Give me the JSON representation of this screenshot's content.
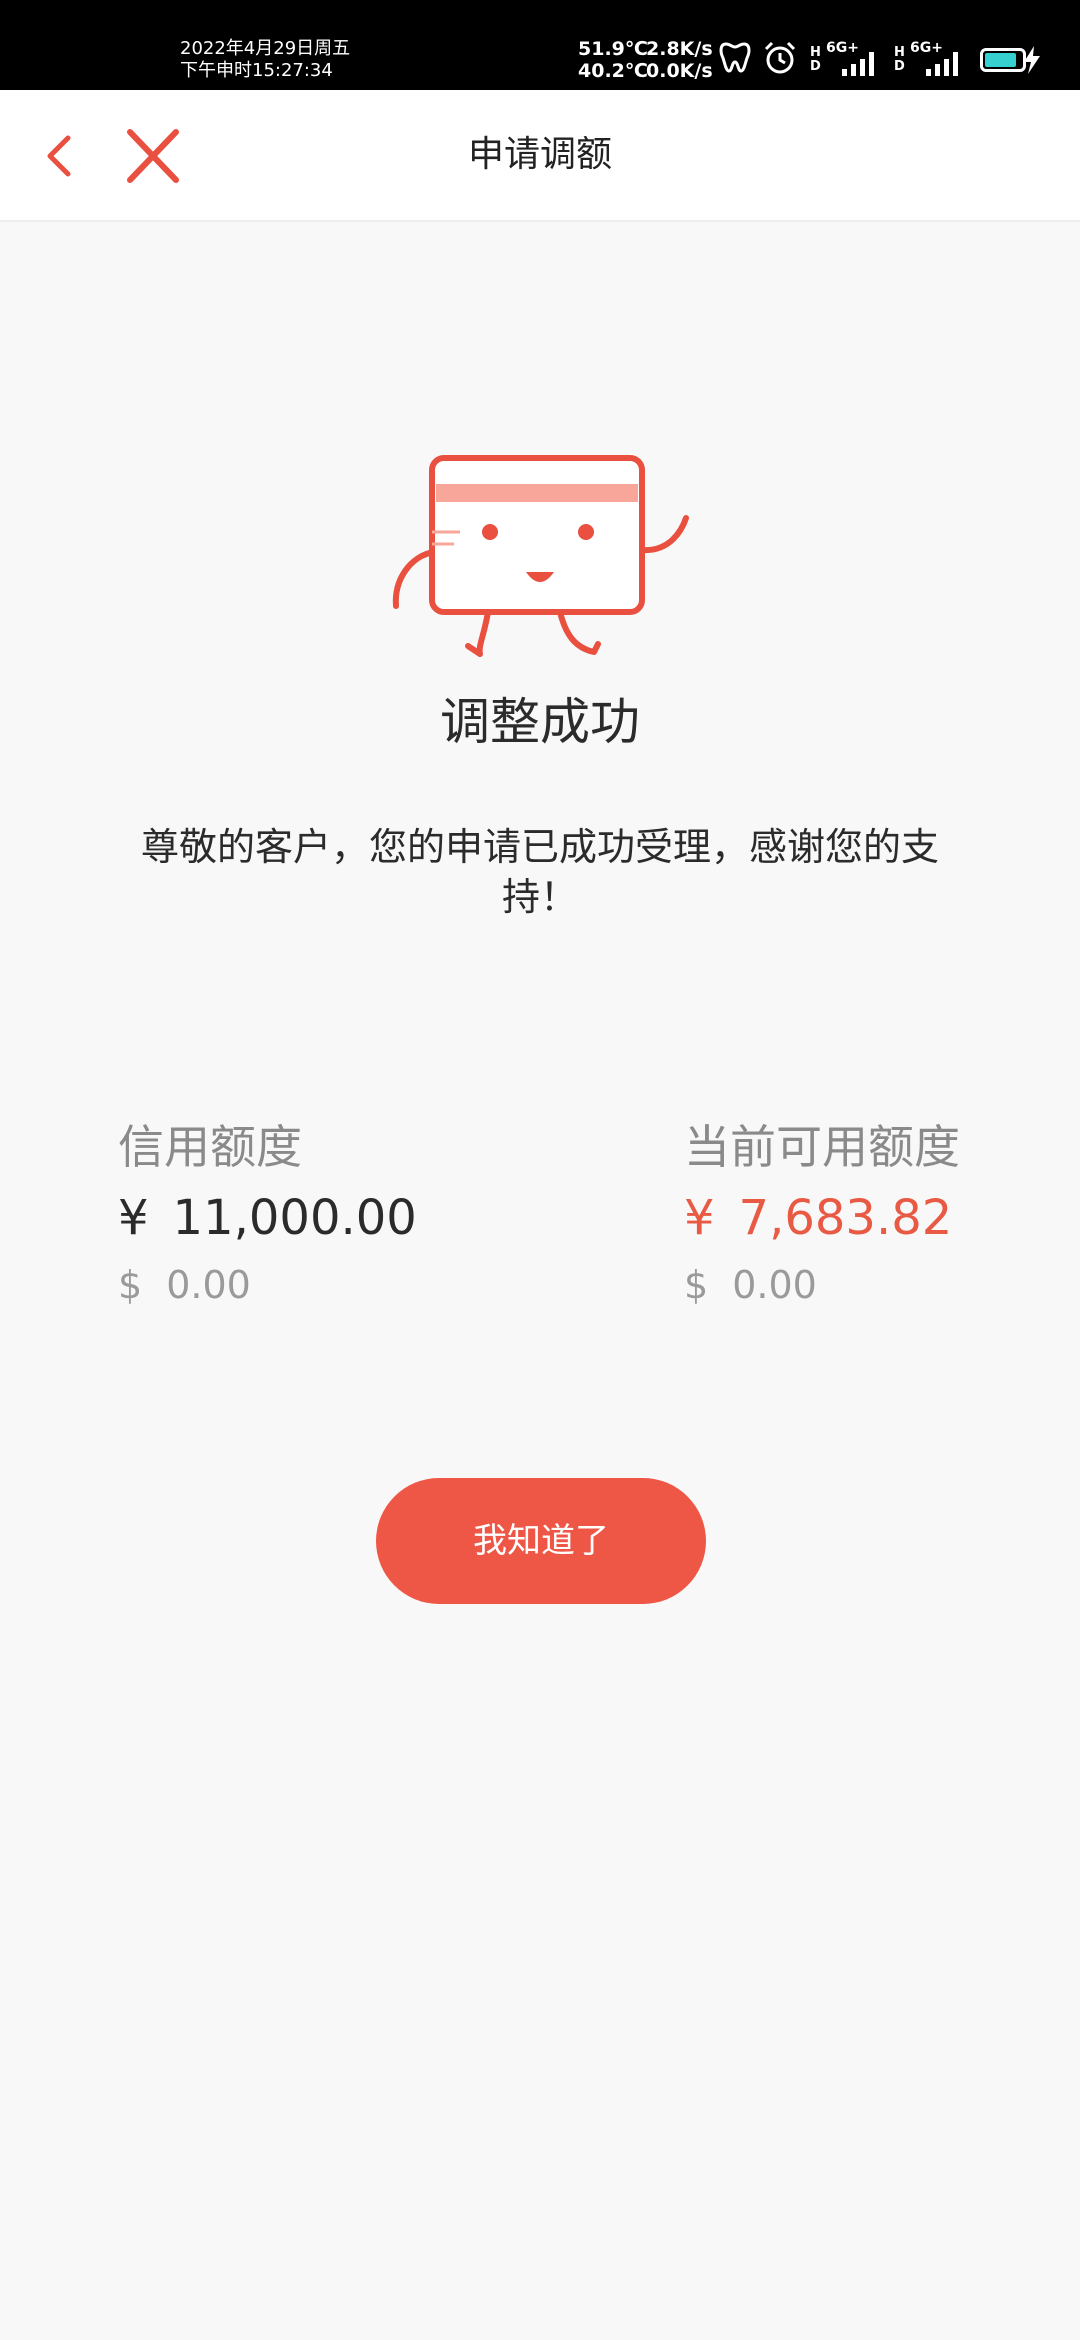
{
  "status_bar": {
    "date": "2022年4月29日周五",
    "time": "下午申时15:27:34",
    "temp_cpu": "51.9℃",
    "temp_battery": "40.2℃",
    "speed_up": "2.8K/s",
    "speed_down": "0.0K/s",
    "hd1": "H D",
    "net1": "6G+",
    "hd2": "H D",
    "net2": "6G+",
    "battery_level": 0.85,
    "battery_color": "#37d0d0"
  },
  "nav": {
    "back_icon": "chevron-left-icon",
    "close_icon": "close-icon",
    "title": "申请调额"
  },
  "result": {
    "title": "调整成功",
    "message": "尊敬的客户，您的申请已成功受理，感谢您的支持！"
  },
  "credit_limit": {
    "label": "信用额度",
    "cny_symbol": "¥",
    "cny_value": "11,000.00",
    "usd_symbol": "$",
    "usd_value": "0.00"
  },
  "available_limit": {
    "label": "当前可用额度",
    "cny_symbol": "¥",
    "cny_value": "7,683.82",
    "usd_symbol": "$",
    "usd_value": "0.00"
  },
  "button": {
    "label": "我知道了"
  },
  "colors": {
    "accent": "#ee5746",
    "amount_red": "#e95a45",
    "background": "#f8f8f8"
  }
}
